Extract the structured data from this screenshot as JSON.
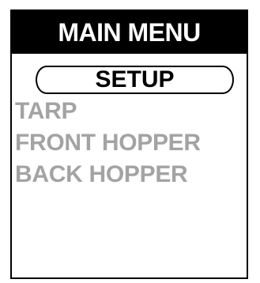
{
  "header": {
    "title": "MAIN MENU"
  },
  "menu": {
    "selected": "SETUP",
    "items": [
      "TARP",
      "FRONT HOPPER",
      "BACK HOPPER"
    ]
  },
  "colors": {
    "title_background": "#000000",
    "title_text": "#ffffff",
    "selected_text": "#000000",
    "item_text": "#a3a3a3"
  }
}
